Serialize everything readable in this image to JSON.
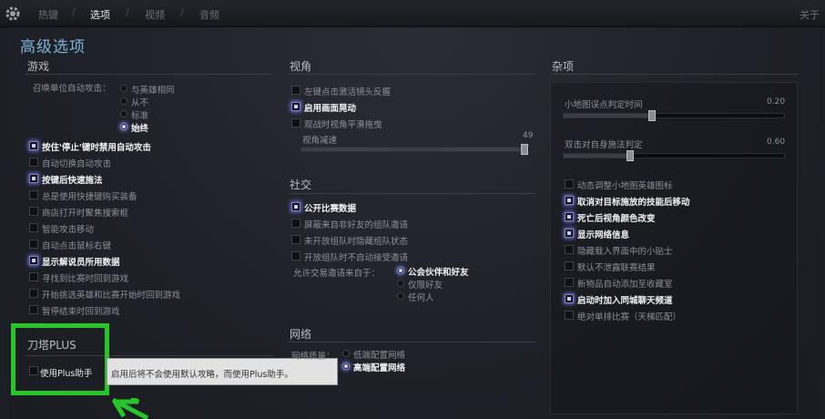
{
  "topbar": {
    "tabs": [
      "热键",
      "选项",
      "视频",
      "音频"
    ],
    "active_tab": "选项",
    "about": "关于"
  },
  "page_title": "高级选项",
  "game": {
    "header": "游戏",
    "autoattack_label": "召唤单位自动攻击：",
    "autoattack_options": [
      "与英雄相同",
      "从不",
      "标准",
      "始终"
    ],
    "autoattack_selected": "始终",
    "items": [
      {
        "label": "按住'停止'键时禁用自动攻击",
        "checked": true
      },
      {
        "label": "自动切换自动攻击",
        "checked": false
      },
      {
        "label": "按键后快速施法",
        "checked": true
      },
      {
        "label": "总是使用快捷键购买装备",
        "checked": false
      },
      {
        "label": "商店打开时聚焦搜索框",
        "checked": false
      },
      {
        "label": "智能攻击移动",
        "checked": false
      },
      {
        "label": "自动点击鼠标右键",
        "checked": false
      },
      {
        "label": "显示解说员所用数据",
        "checked": true
      },
      {
        "label": "寻找到比赛时回到游戏",
        "checked": false
      },
      {
        "label": "开始挑选英雄和比赛开始时回到游戏",
        "checked": false
      },
      {
        "label": "暂停结束时回到游戏",
        "checked": false
      }
    ]
  },
  "plus": {
    "header": "刀塔PLUS",
    "item": {
      "label": "使用Plus助手",
      "checked": false
    },
    "tooltip": "启用后将不会使用默认攻略，而使用Plus助手。"
  },
  "camera": {
    "header": "视角",
    "items": [
      {
        "label": "左键点击激活镜头反握",
        "checked": false
      },
      {
        "label": "启用画面晃动",
        "checked": true
      },
      {
        "label": "观战时视角平滑拖曳",
        "checked": false
      }
    ],
    "slider_label": "视角减速",
    "slider_value": "49",
    "slider_fraction": 0.98
  },
  "social": {
    "header": "社交",
    "items": [
      {
        "label": "公开比赛数据",
        "checked": true
      },
      {
        "label": "屏蔽来自非好友的组队邀请",
        "checked": false
      },
      {
        "label": "未开放组队时隐藏组队状态",
        "checked": false
      },
      {
        "label": "开放组队时不自动接受邀请",
        "checked": false
      }
    ],
    "trade_label": "允许交易邀请来自于：",
    "trade_options": [
      "公会伙伴和好友",
      "仅限好友",
      "任何人"
    ],
    "trade_selected": "公会伙伴和好友"
  },
  "network": {
    "header": "网络",
    "quality_label": "网络质量：",
    "options": [
      "低端配置网络",
      "高端配置网络"
    ],
    "selected": "高端配置网络"
  },
  "misc": {
    "header": "杂项",
    "slider1_label": "小地图误点判定时间",
    "slider1_value": "0.20",
    "slider1_fraction": 0.4,
    "slider2_label": "双击对自身施法判定",
    "slider2_value": "0.60",
    "slider2_fraction": 0.3,
    "items": [
      {
        "label": "动态调整小地图英雄图标",
        "checked": false
      },
      {
        "label": "取消对目标施放的技能后移动",
        "checked": true
      },
      {
        "label": "死亡后视角颜色改变",
        "checked": true
      },
      {
        "label": "显示网络信息",
        "checked": true
      },
      {
        "label": "隐藏载入界面中的小贴士",
        "checked": false
      },
      {
        "label": "默认不泄露联赛结果",
        "checked": false
      },
      {
        "label": "新物品自动添加至收藏室",
        "checked": false
      },
      {
        "label": "启动时加入同城聊天频道",
        "checked": true
      },
      {
        "label": "绝对单排比赛（天梯匹配）",
        "checked": false
      }
    ]
  },
  "colors": {
    "accent": "#7fb2da",
    "highlight_green": "#27c42a",
    "checkbox_glow": "#6c74d8"
  }
}
